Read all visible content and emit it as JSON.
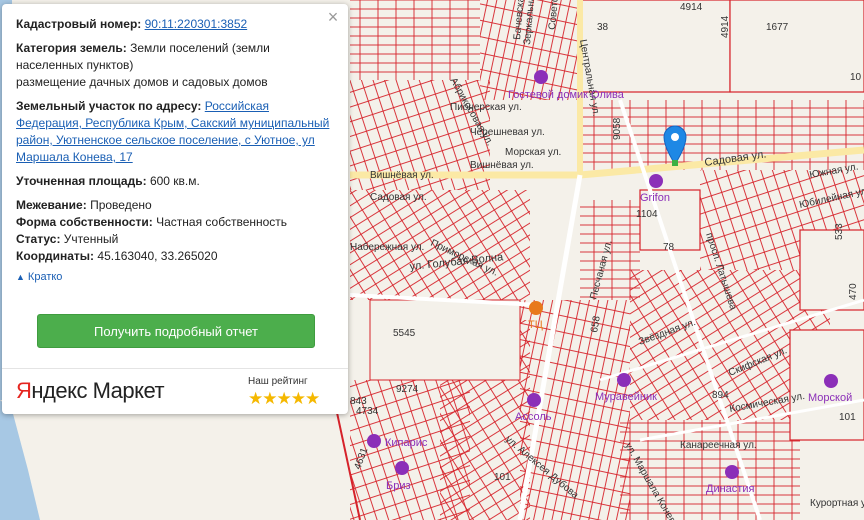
{
  "panel": {
    "close_symbol": "×",
    "cadastral_label": "Кадастровый номер:",
    "cadastral_value": "90:11:220301:3852",
    "land_category_label": "Категория земель:",
    "land_category_value": "Земли поселений (земли населенных пунктов)",
    "land_use": "размещение дачных домов и садовых домов",
    "address_label": "Земельный участок по адресу:",
    "address_value": "Российская Федерация, Республика Крым, Сакский муниципальный район, Уютненское сельское поселение, с Уютное, ул Маршала Конева, 17",
    "area_label": "Уточненная площадь:",
    "area_value": "600 кв.м.",
    "survey_label": "Межевание:",
    "survey_value": "Проведено",
    "ownership_label": "Форма собственности:",
    "ownership_value": "Частная собственность",
    "status_label": "Статус:",
    "status_value": "Учтенный",
    "coords_label": "Координаты:",
    "coords_value": "45.163040, 33.265020",
    "collapse_link": "Кратко",
    "report_button": "Получить подробный отчет",
    "brand_part1": "Я",
    "brand_part2": "ндекс",
    "brand_part3": " Маркет",
    "rating_label": "Наш рейтинг",
    "rating_stars": 5,
    "rating_glyphs": "★★★★★"
  },
  "map": {
    "streets": [
      "Садовая ул.",
      "Вишнёвая ул.",
      "Вишнёвая ул.",
      "Садовая ул.",
      "Приморская ул.",
      "ул. Голубая Волна",
      "Песчаная ул.",
      "просп. Латышева",
      "Звёздная ул.",
      "Скифская ул.",
      "Космическая ул.",
      "Канареечная ул.",
      "Курортная ул.",
      "ул. Маршала Конева",
      "Южная ул.",
      "Юбилейная ул.",
      "Черешневая ул.",
      "Морская ул.",
      "Зеркальная ул.",
      "Центральная ул.",
      "Бачевская ул.",
      "Советская ул.",
      "Абрикосовая ул.",
      "ул. Алексея Дубова",
      "Набережная ул.",
      "Пионерская ул."
    ],
    "parcel_numbers": [
      "38",
      "4914",
      "4914",
      "1677",
      "10",
      "9058",
      "1104",
      "78",
      "5545",
      "658",
      "894",
      "101",
      "4734",
      "9274",
      "4631",
      "843",
      "470",
      "101",
      "533"
    ],
    "pois": [
      {
        "name": "Гостевой домик Олива",
        "icon": "hotel-icon"
      },
      {
        "name": "Grifon",
        "icon": "hotel-icon"
      },
      {
        "name": "Муравейник",
        "icon": "shop-icon"
      },
      {
        "name": "Морской",
        "icon": "hotel-icon"
      },
      {
        "name": "Кипарис",
        "icon": "hotel-icon"
      },
      {
        "name": "Бриз",
        "icon": "hotel-icon"
      },
      {
        "name": "Династия",
        "icon": "hotel-icon"
      },
      {
        "name": "Ассоль",
        "icon": "hotel-icon"
      },
      {
        "name": "ТЦ",
        "icon": "shopping-center-icon"
      }
    ],
    "marker_icon": "map-pin-icon",
    "colors": {
      "parcel": "#d6222a",
      "pin": "#1e88e5",
      "poi": "#8b2fb8",
      "sea": "#a7c8e4",
      "road": "#fbe9a5"
    }
  }
}
